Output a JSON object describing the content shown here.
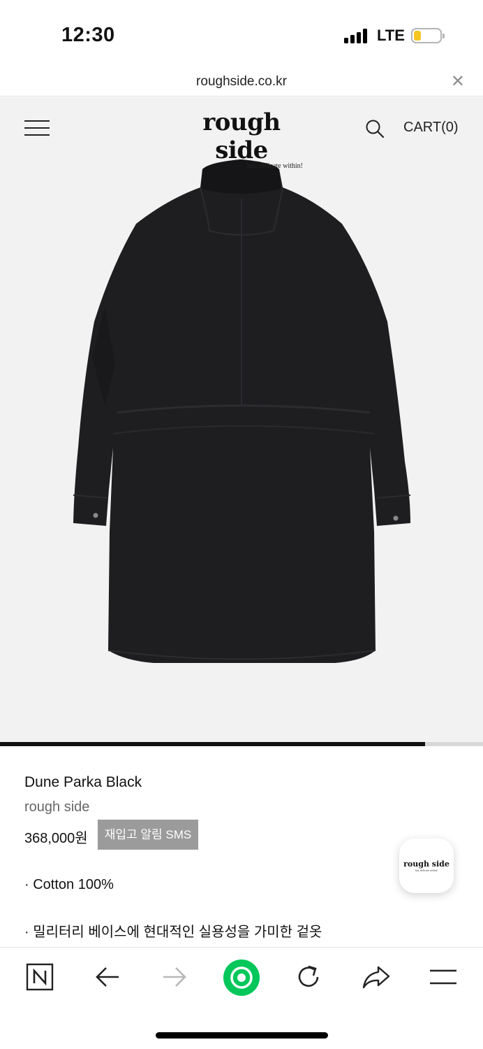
{
  "status": {
    "time": "12:30",
    "network": "LTE",
    "battery_level": 0.25,
    "battery_color": "#f5c623"
  },
  "browser": {
    "url": "roughside.co.kr",
    "close_icon": "close-icon"
  },
  "site": {
    "logo": "rough side",
    "tagline": "but, delicate within!",
    "cart_label": "CART(0)",
    "menu_icon": "hamburger-menu-icon",
    "search_icon": "search-icon"
  },
  "gallery": {
    "progress": 0.88,
    "background": "#f2f2f2"
  },
  "product": {
    "name": "Dune Parka Black",
    "brand": "rough side",
    "price": "368,000원",
    "restock_button": "재입고 알림 SMS",
    "description": [
      "· Cotton 100%",
      "· 밀리터리 베이스에 현대적인 실용성을 가미한 겉옷"
    ]
  },
  "floating_button": {
    "logo": "rough side",
    "tagline": "but, delicate within!"
  },
  "toolbar": {
    "items": [
      "naver-home-icon",
      "back-arrow-icon",
      "forward-arrow-icon",
      "green-dot-icon",
      "reload-icon",
      "share-icon",
      "menu-icon"
    ],
    "accent": "#03c75a"
  }
}
